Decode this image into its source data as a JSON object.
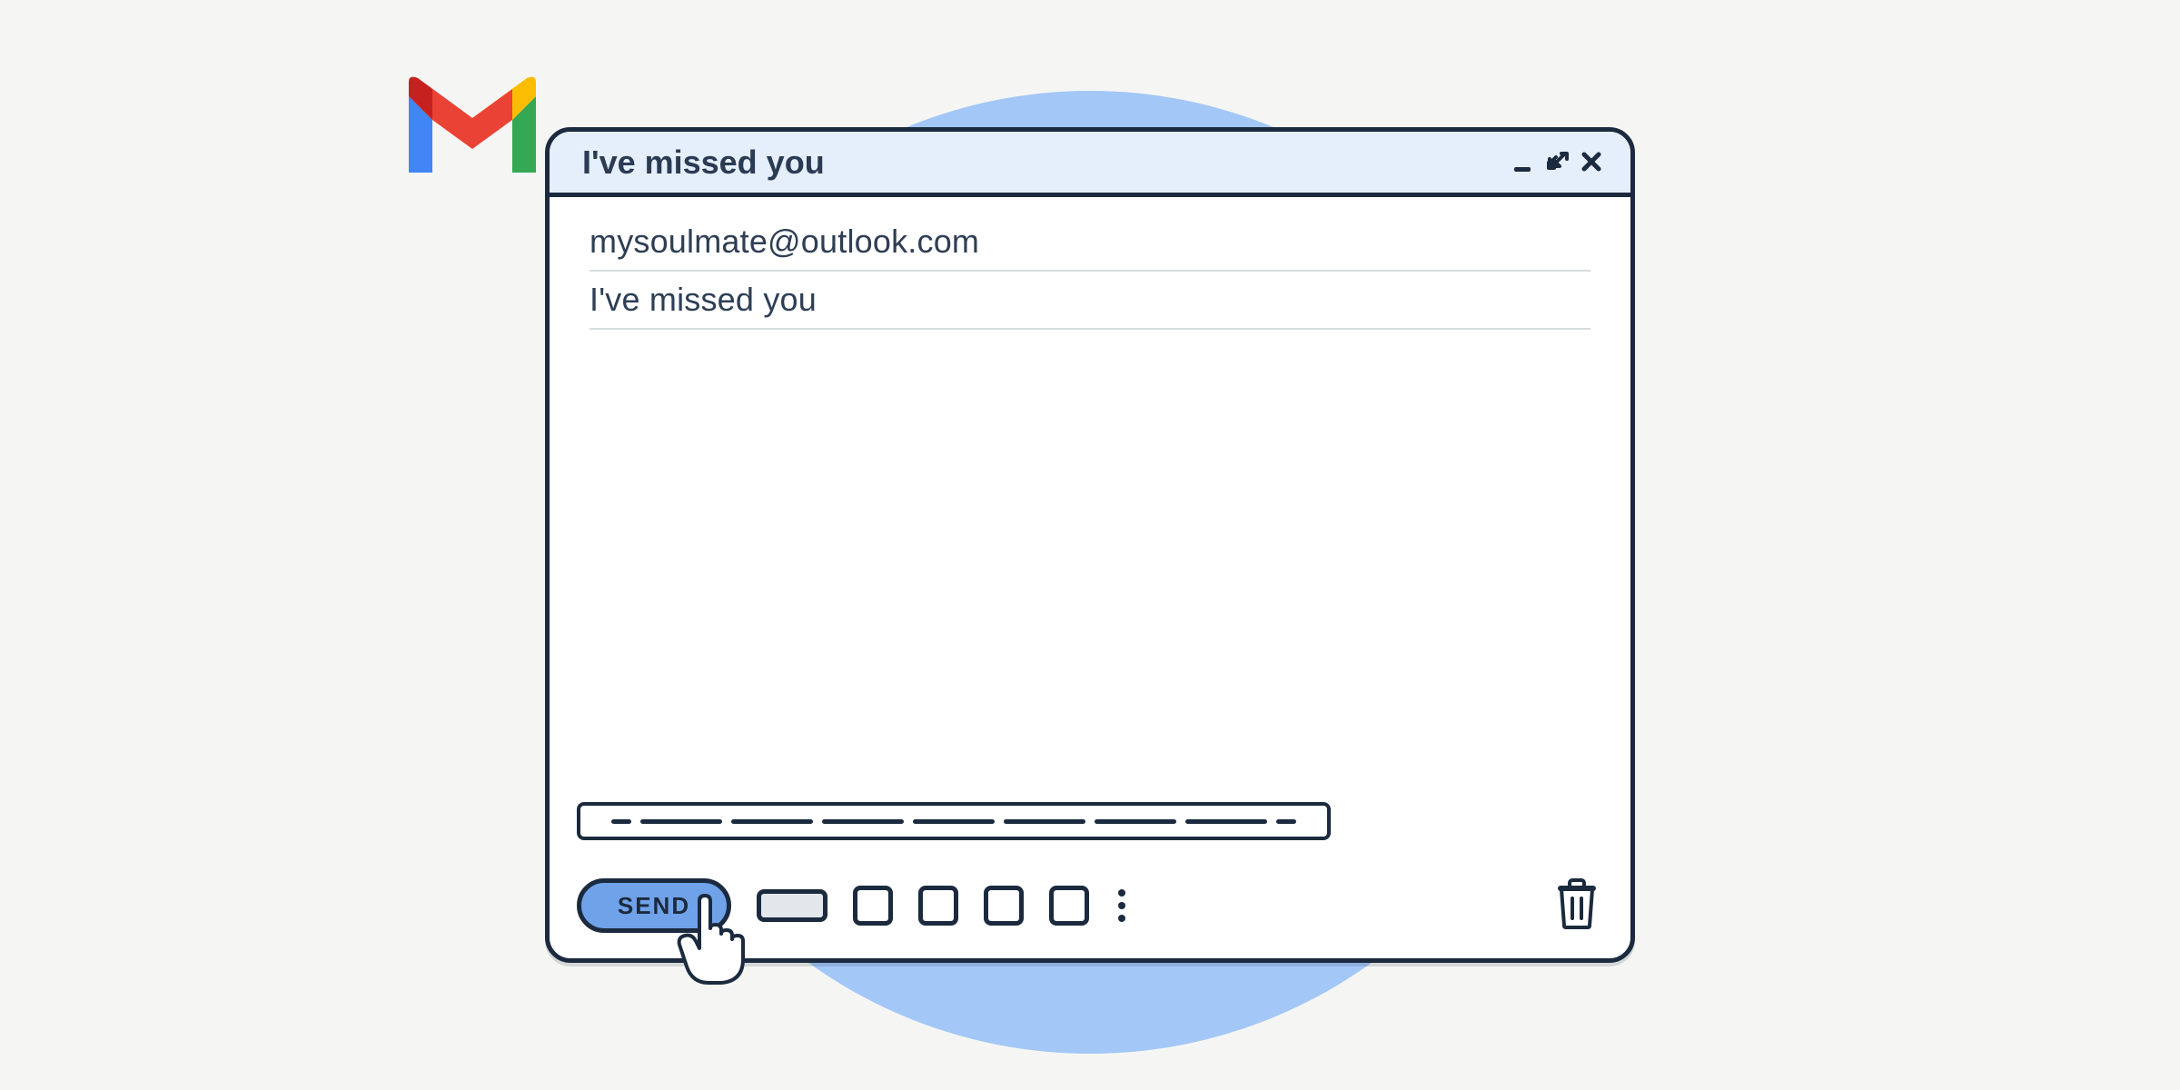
{
  "app": {
    "name": "Gmail"
  },
  "window": {
    "title": "I've missed you",
    "controls": {
      "minimize": "minimize-icon",
      "expand": "expand-icon",
      "close": "close-icon"
    }
  },
  "compose": {
    "to": "mysoulmate@outlook.com",
    "subject": "I've missed you",
    "body": "",
    "send_label": "SEND"
  },
  "toolbar": {
    "icons": [
      "formatting-placeholder",
      "tool-1",
      "tool-2",
      "tool-3",
      "tool-4"
    ],
    "more": "more-options-icon",
    "delete": "trash-icon"
  },
  "colors": {
    "accent_blue": "#6fa2e8",
    "outline": "#1b2a3e",
    "titlebar_bg": "#e5eefb",
    "bg_circle": "#a3c7f7",
    "page_bg": "#f5f6f4"
  }
}
